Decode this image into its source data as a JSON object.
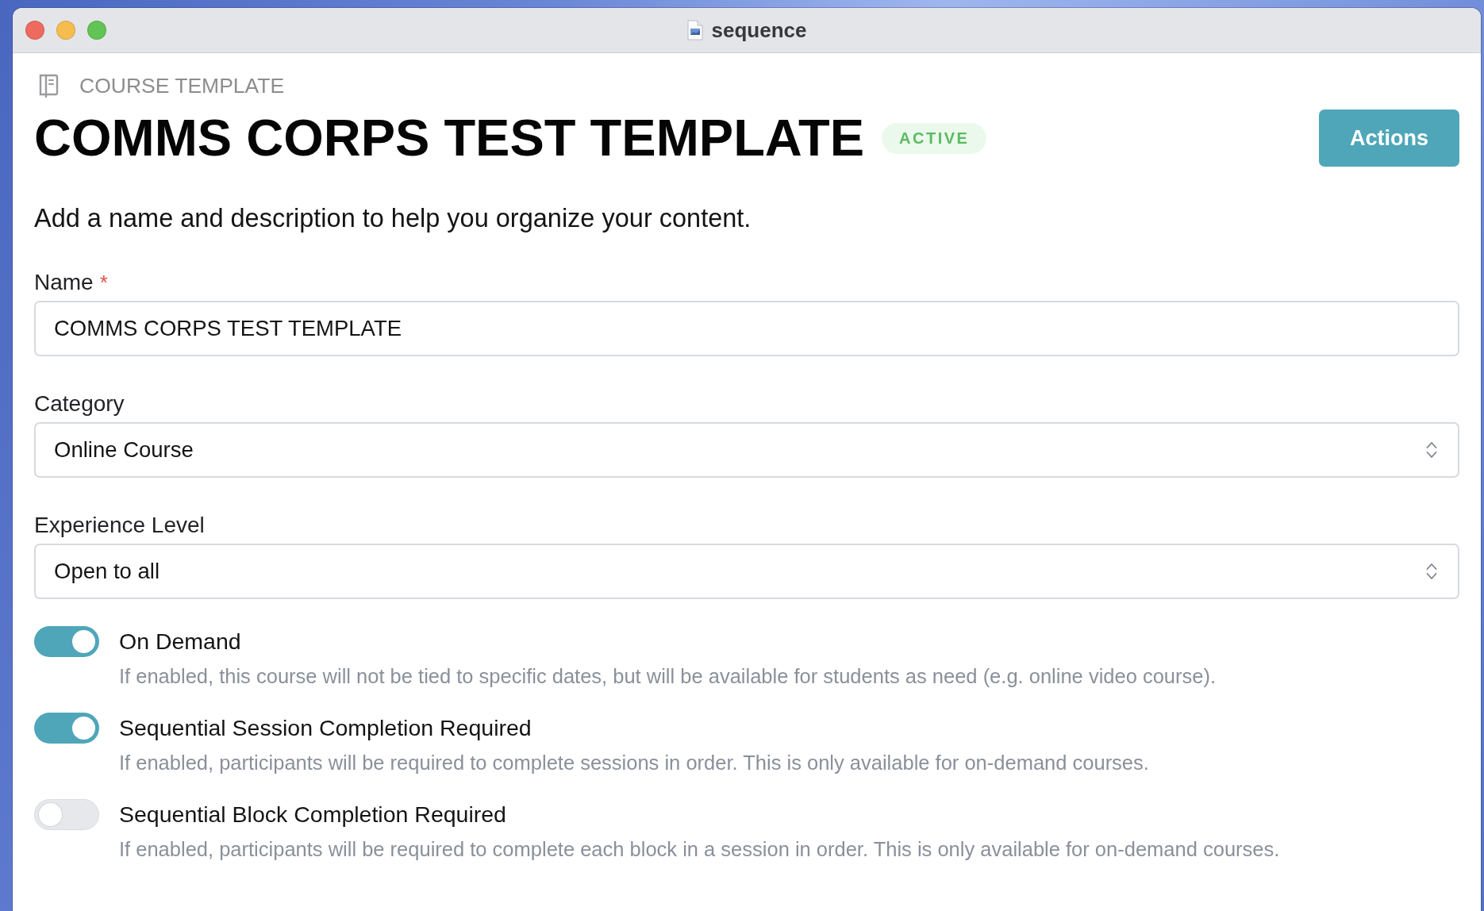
{
  "window": {
    "title": "sequence"
  },
  "header": {
    "eyebrow": "COURSE TEMPLATE",
    "title": "COMMS CORPS TEST TEMPLATE",
    "status": "ACTIVE",
    "actions_button": "Actions"
  },
  "intro": "Add a name and description to help you organize your content.",
  "fields": [
    {
      "kind": "text",
      "label": "Name",
      "required_mark": "*",
      "value": "COMMS CORPS TEST TEMPLATE"
    },
    {
      "kind": "select",
      "label": "Category",
      "value": "Online Course"
    },
    {
      "kind": "select",
      "label": "Experience Level",
      "value": "Open to all"
    }
  ],
  "toggles": [
    {
      "label": "On Demand",
      "on": true,
      "hint": "If enabled, this course will not be tied to specific dates, but will be available for students as need (e.g. online video course)."
    },
    {
      "label": "Sequential Session Completion Required",
      "on": true,
      "hint": "If enabled, participants will be required to complete sessions in order. This is only available for on-demand courses."
    },
    {
      "label": "Sequential Block Completion Required",
      "on": false,
      "hint": "If enabled, participants will be required to complete each block in a session in order. This is only available for on-demand courses."
    }
  ]
}
